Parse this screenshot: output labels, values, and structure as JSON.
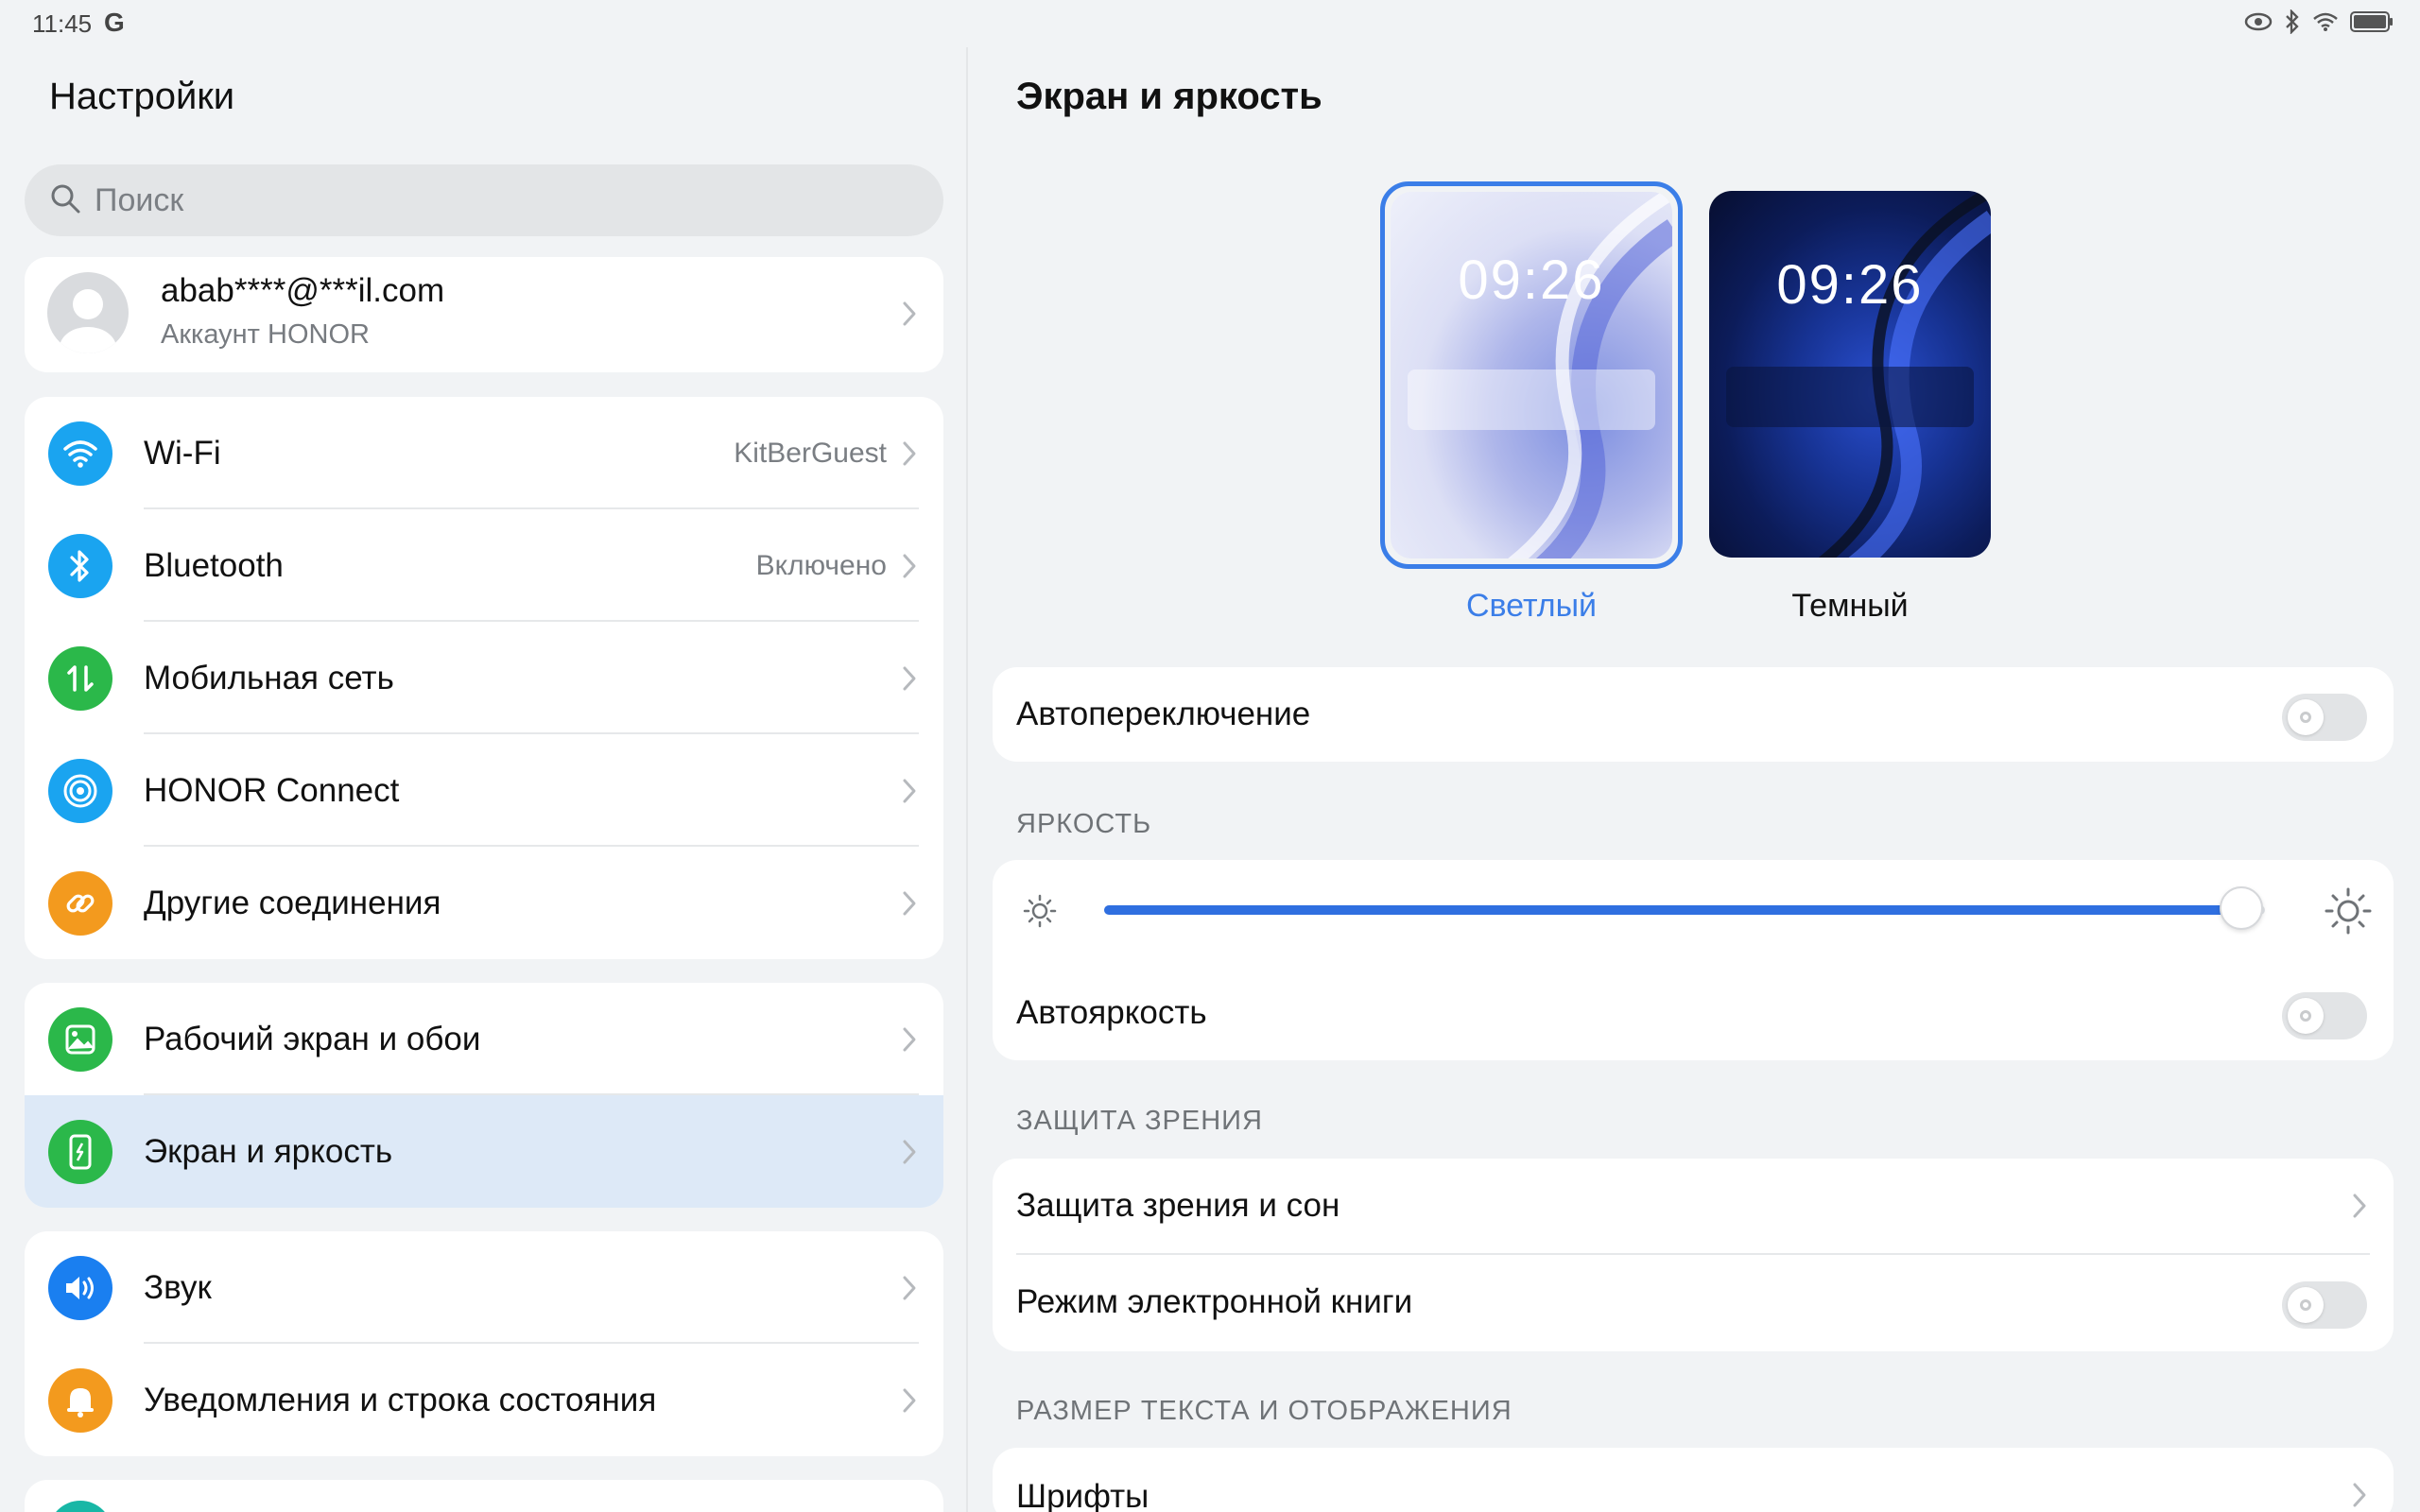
{
  "status_bar": {
    "time": "11:45",
    "g_label": "G"
  },
  "left": {
    "title": "Настройки",
    "search": {
      "placeholder": "Поиск"
    },
    "account": {
      "email": "abab****@***il.com",
      "subtitle": "Аккаунт HONOR"
    },
    "group1": [
      {
        "label": "Wi-Fi",
        "value": "KitBerGuest",
        "icon": "wifi-icon",
        "color": "#1aa4f0"
      },
      {
        "label": "Bluetooth",
        "value": "Включено",
        "icon": "bluetooth-icon",
        "color": "#1aa4f0"
      },
      {
        "label": "Мобильная сеть",
        "value": "",
        "icon": "mobile-data-icon",
        "color": "#2bb84a"
      },
      {
        "label": "HONOR Connect",
        "value": "",
        "icon": "honor-connect-icon",
        "color": "#1aa4f0"
      },
      {
        "label": "Другие соединения",
        "value": "",
        "icon": "link-icon",
        "color": "#f39a1e"
      }
    ],
    "group2": [
      {
        "label": "Рабочий экран и обои",
        "icon": "wallpaper-icon",
        "color": "#2bb84a"
      },
      {
        "label": "Экран и яркость",
        "icon": "display-icon",
        "color": "#2bb84a",
        "selected": true
      }
    ],
    "group3": [
      {
        "label": "Звук",
        "icon": "sound-icon",
        "color": "#1a7ff0"
      },
      {
        "label": "Уведомления и строка состояния",
        "icon": "bell-icon",
        "color": "#f39a1e"
      }
    ]
  },
  "right": {
    "title": "Экран и яркость",
    "themes": [
      {
        "label": "Светлый",
        "preview_time": "09:26",
        "selected": true,
        "accent": "#3b7ee8"
      },
      {
        "label": "Темный",
        "preview_time": "09:26",
        "selected": false
      }
    ],
    "auto_switch": {
      "label": "Автопереключение",
      "on": false
    },
    "brightness_section": "ЯРКОСТЬ",
    "brightness": {
      "level_percent": 98
    },
    "auto_brightness": {
      "label": "Автояркость",
      "on": false
    },
    "eye_section": "ЗАЩИТА ЗРЕНИЯ",
    "eye_comfort": {
      "label": "Защита зрения и сон"
    },
    "ebook_mode": {
      "label": "Режим электронной книги",
      "on": false
    },
    "text_section": "РАЗМЕР ТЕКСТА И ОТОБРАЖЕНИЯ",
    "fonts": {
      "label": "Шрифты"
    }
  },
  "colors": {
    "accent": "#2f6fe0",
    "selected_row": "#dde9f7",
    "background": "#f1f3f5"
  }
}
